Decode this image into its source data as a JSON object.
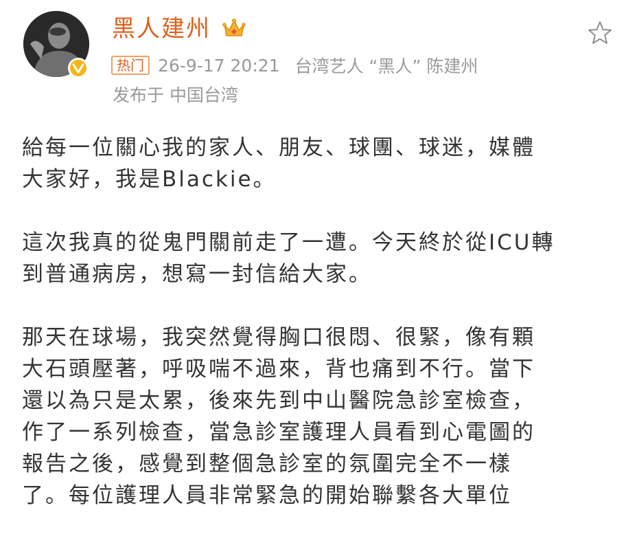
{
  "post": {
    "username": "黑人建州",
    "badge": "热门",
    "time": "26-9-17 20:21",
    "source": "台湾艺人 “黑人” 陈建州",
    "location": "发布于 中国台湾"
  },
  "content": {
    "p1_l1": "給每一位關心我的家人、朋友、球團、球迷，媒體",
    "p1_l2": "大家好，我是Blackie。",
    "p2_l1": "這次我真的從鬼門關前走了一遭。今天終於從ICU轉",
    "p2_l2": "到普通病房，想寫一封信給大家。",
    "p3_l1": "那天在球場，我突然覺得胸口很悶、很緊，像有顆",
    "p3_l2": "大石頭壓著，呼吸喘不過來，背也痛到不行。當下",
    "p3_l3": "還以為只是太累，後來先到中山醫院急診室檢查，",
    "p3_l4": "作了一系列檢查，當急診室護理人員看到心電圖的",
    "p3_l5": "報告之後，感覺到整個急診室的氛圍完全不一樣",
    "p3_l6": "了。每位護理人員非常緊急的開始聯繫各大單位"
  },
  "icons": {
    "avatar": "avatar-photo",
    "verified": "verified-v-icon",
    "crown": "crown-icon",
    "favorite": "star-outline-icon"
  },
  "colors": {
    "username": "#e0601b",
    "meta": "#999999",
    "text": "#333333",
    "verified": "#f6b51a"
  }
}
